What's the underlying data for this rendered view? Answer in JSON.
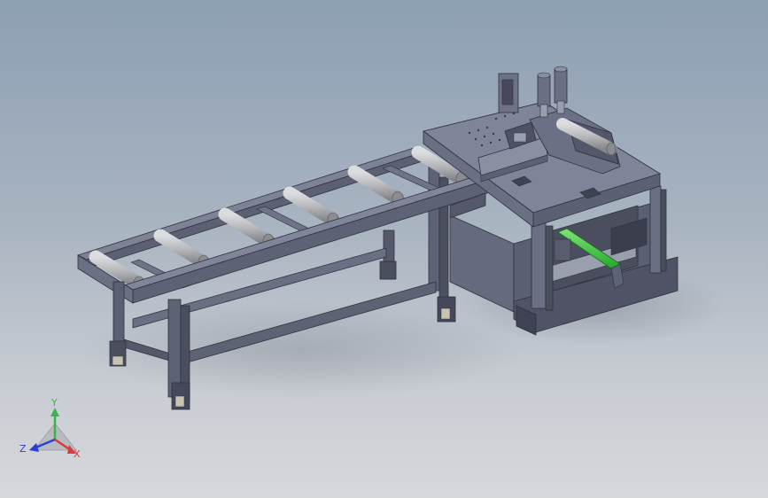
{
  "viewport": {
    "model": "roller-conveyor-and-cutting-station",
    "colors": {
      "frame": "#5d6275",
      "frame_dark": "#3e4252",
      "frame_light": "#7d8296",
      "roller": "#b8b9bd",
      "highlight_part": "#35c93a",
      "background_top": "#8d9fb3",
      "background_bottom": "#d6d8dc"
    }
  },
  "triad": {
    "axes": [
      {
        "name": "x",
        "label": "X",
        "color": "#d63c3c"
      },
      {
        "name": "y",
        "label": "Y",
        "color": "#3ab34a"
      },
      {
        "name": "z",
        "label": "Z",
        "color": "#2b3fd1"
      }
    ]
  }
}
